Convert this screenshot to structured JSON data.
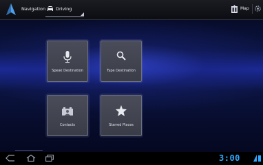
{
  "header": {
    "app_title": "Navigation",
    "mode_label": "Driving",
    "map_label": "Map"
  },
  "tiles": [
    {
      "label": "Speak Destination",
      "icon": "microphone-icon"
    },
    {
      "label": "Type Destination",
      "icon": "search-icon"
    },
    {
      "label": "Contacts",
      "icon": "contacts-icon"
    },
    {
      "label": "Starred Places",
      "icon": "star-icon"
    }
  ],
  "system_bar": {
    "clock": "3:00",
    "nav_icons": [
      "back-icon",
      "home-icon",
      "recent-apps-icon"
    ]
  },
  "colors": {
    "clock": "#2fa7ff",
    "accent_blue": "#2a3cc8"
  }
}
